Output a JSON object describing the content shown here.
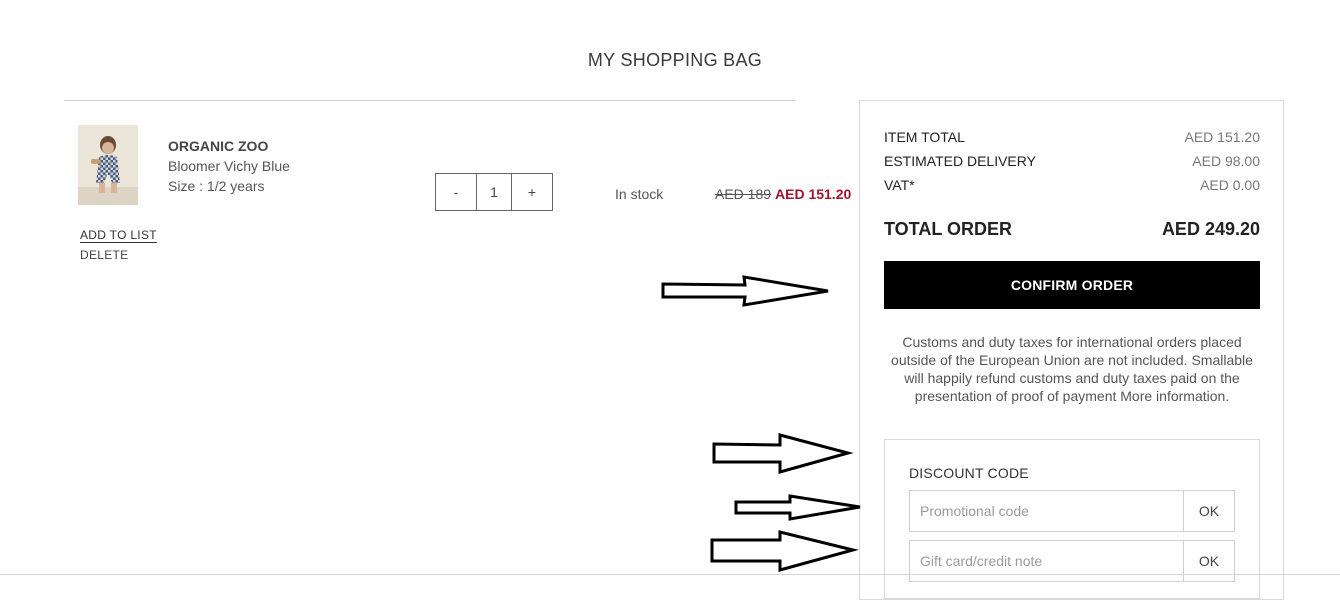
{
  "page": {
    "title": "MY SHOPPING BAG"
  },
  "product": {
    "image_icon": "child-in-checked-romper-photo",
    "brand": "ORGANIC ZOO",
    "name": "Bloomer Vichy Blue",
    "size": "Size : 1/2 years",
    "add_to_list": "ADD TO LIST",
    "delete": "DELETE",
    "qty_minus": "-",
    "qty_value": "1",
    "qty_plus": "+",
    "stock_status": "In stock",
    "old_price": "AED 189",
    "new_price": "AED 151.20",
    "sale_color": "#a0142d"
  },
  "summary": {
    "item_total_label": "ITEM TOTAL",
    "item_total_value": "AED 151.20",
    "delivery_label": "ESTIMATED DELIVERY",
    "delivery_value": "AED 98.00",
    "vat_label": "VAT*",
    "vat_value": "AED 0.00",
    "total_label": "TOTAL ORDER",
    "total_value": "AED 249.20",
    "confirm_label": "CONFIRM ORDER",
    "notice": "Customs and duty taxes for international orders placed outside of the European Union are not included. Smallable will happily refund customs and duty taxes paid on the presentation of proof of payment  More information."
  },
  "discount": {
    "title": "DISCOUNT CODE",
    "promo_placeholder": "Promotional code",
    "promo_ok": "OK",
    "gift_placeholder": "Gift card/credit note",
    "gift_ok": "OK"
  },
  "annotations": {
    "arrow_icon": "hand-drawn-right-arrow-icon"
  }
}
